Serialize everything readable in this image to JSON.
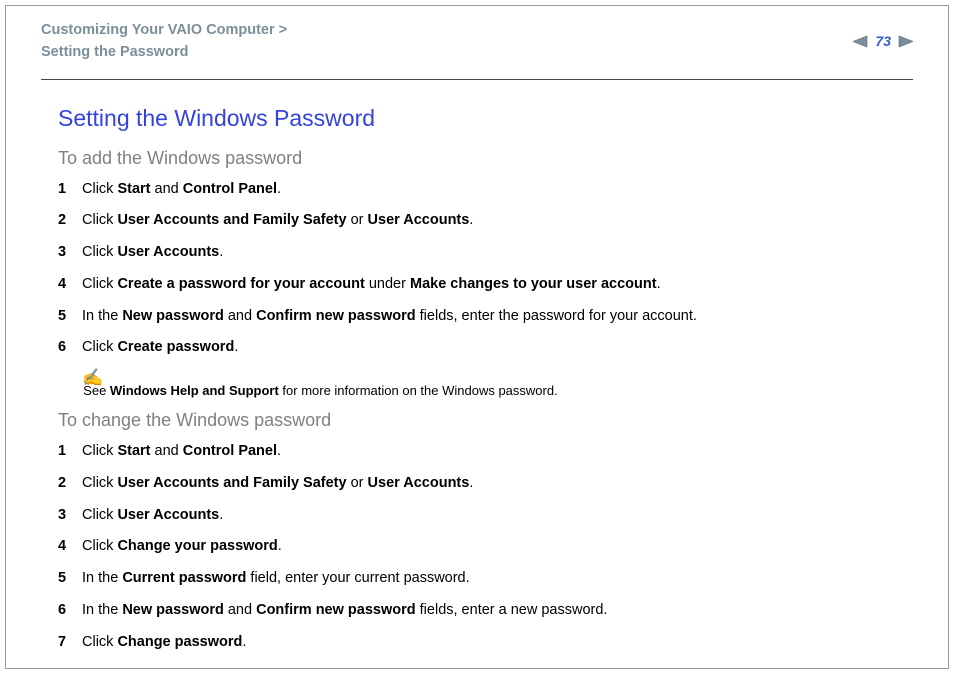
{
  "header": {
    "breadcrumb_line1": "Customizing Your VAIO Computer >",
    "breadcrumb_line2": "Setting the Password",
    "page_number": "73"
  },
  "title": "Setting the Windows Password",
  "section_add": {
    "heading": "To add the Windows password",
    "steps": [
      {
        "n": "1",
        "pre": "Click ",
        "b1": "Start",
        "mid": " and ",
        "b2": "Control Panel",
        "post": "."
      },
      {
        "n": "2",
        "pre": "Click ",
        "b1": "User Accounts and Family Safety",
        "mid": " or ",
        "b2": "User Accounts",
        "post": "."
      },
      {
        "n": "3",
        "pre": "Click ",
        "b1": "User Accounts",
        "mid": "",
        "b2": "",
        "post": "."
      },
      {
        "n": "4",
        "pre": "Click ",
        "b1": "Create a password for your account",
        "mid": " under ",
        "b2": "Make changes to your user account",
        "post": "."
      },
      {
        "n": "5",
        "pre": "In the ",
        "b1": "New password",
        "mid": " and ",
        "b2": "Confirm new password",
        "post": " fields, enter the password for your account."
      },
      {
        "n": "6",
        "pre": "Click ",
        "b1": "Create password",
        "mid": "",
        "b2": "",
        "post": "."
      }
    ]
  },
  "note": {
    "icon": "✍",
    "pre": "See ",
    "bold": "Windows Help and Support",
    "post": " for more information on the Windows password."
  },
  "section_change": {
    "heading": "To change the Windows password",
    "steps": [
      {
        "n": "1",
        "pre": "Click ",
        "b1": "Start",
        "mid": " and ",
        "b2": "Control Panel",
        "post": "."
      },
      {
        "n": "2",
        "pre": "Click ",
        "b1": "User Accounts and Family Safety",
        "mid": " or ",
        "b2": "User Accounts",
        "post": "."
      },
      {
        "n": "3",
        "pre": "Click ",
        "b1": "User Accounts",
        "mid": "",
        "b2": "",
        "post": "."
      },
      {
        "n": "4",
        "pre": "Click ",
        "b1": "Change your password",
        "mid": "",
        "b2": "",
        "post": "."
      },
      {
        "n": "5",
        "pre": "In the ",
        "b1": "Current password",
        "mid": "",
        "b2": "",
        "post": " field, enter your current password."
      },
      {
        "n": "6",
        "pre": "In the ",
        "b1": "New password",
        "mid": " and ",
        "b2": "Confirm new password",
        "post": " fields, enter a new password."
      },
      {
        "n": "7",
        "pre": "Click ",
        "b1": "Change password",
        "mid": "",
        "b2": "",
        "post": "."
      }
    ]
  }
}
